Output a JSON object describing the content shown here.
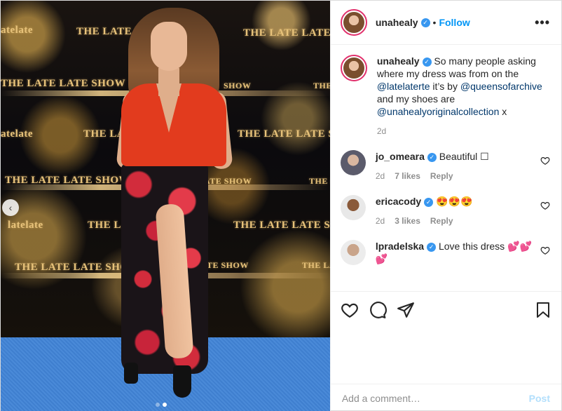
{
  "post": {
    "author": "unahealy",
    "follow_label": "Follow",
    "bullet": "•",
    "more_label": "•••"
  },
  "photo": {
    "logo_main": "THE LATE LATE SHOW",
    "logo_short": "THE LATE LATE",
    "logo_handle": "latelate",
    "logo_handle2": "atelate",
    "logo_short2": "THE LATE L",
    "logo_show": "ATE SHOW",
    "logo_the": "THE",
    "logo_the_l": "THE L",
    "logo_the_la": "THE LA",
    "logo_show2": "SHOW",
    "logo_show3": "TE SHOW",
    "slides": 2,
    "active_slide": 1
  },
  "caption": {
    "username": "unahealy",
    "text_before": "So many people asking where my dress was from on the",
    "mention1": "@latelaterte",
    "text_mid": "it’s by",
    "mention2": "@queensofarchive",
    "text_mid2": "and my shoes are",
    "mention3": "@unahealyoriginalcollection",
    "text_end": "x",
    "time": "2d"
  },
  "comments": [
    {
      "username": "jo_omeara",
      "text": "Beautiful ☐",
      "time": "2d",
      "likes": "7 likes",
      "reply": "Reply"
    },
    {
      "username": "ericacody",
      "text": "😍😍😍",
      "time": "2d",
      "likes": "3 likes",
      "reply": "Reply"
    },
    {
      "username": "lpradelska",
      "text": "Love this dress 💕💕💕",
      "time": "",
      "likes": "",
      "reply": ""
    }
  ],
  "add_comment": {
    "placeholder": "Add a comment…",
    "post_label": "Post"
  },
  "colors": {
    "link": "#00376b",
    "follow": "#0095f6",
    "verified": "#3897f0"
  }
}
